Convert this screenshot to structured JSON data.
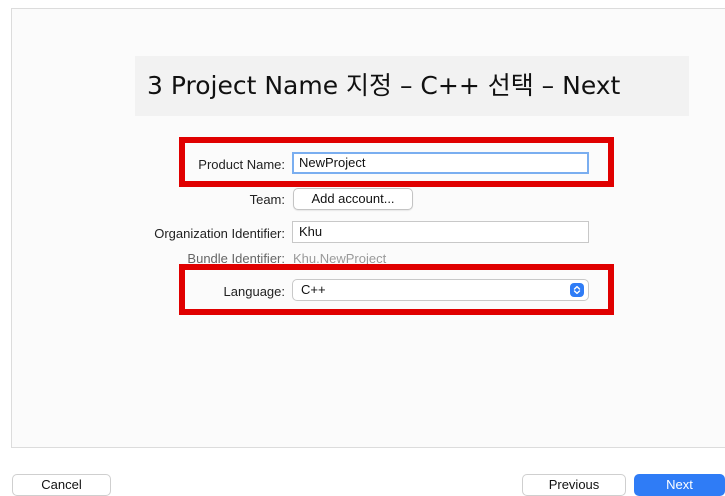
{
  "caption": "3 Project Name 지정 – C++ 선택 – Next",
  "form": {
    "product_name": {
      "label": "Product Name:",
      "value": "NewProject"
    },
    "team": {
      "label": "Team:",
      "button_label": "Add account..."
    },
    "organization_identifier": {
      "label": "Organization Identifier:",
      "value": "Khu"
    },
    "bundle_identifier": {
      "label": "Bundle Identifier:",
      "value": "Khu.NewProject"
    },
    "language": {
      "label": "Language:",
      "selected": "C++"
    }
  },
  "footer": {
    "cancel_label": "Cancel",
    "previous_label": "Previous",
    "next_label": "Next"
  },
  "colors": {
    "highlight": "#e00000",
    "accent": "#2f7cf6",
    "focus_ring": "#7aaef0"
  },
  "icons": {
    "language_popup": "up-down-chevron-icon"
  }
}
